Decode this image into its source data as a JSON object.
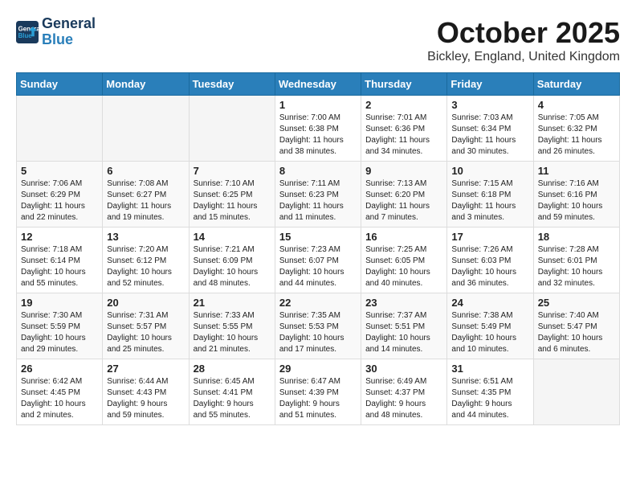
{
  "logo": {
    "line1": "General",
    "line2": "Blue"
  },
  "title": "October 2025",
  "location": "Bickley, England, United Kingdom",
  "weekdays": [
    "Sunday",
    "Monday",
    "Tuesday",
    "Wednesday",
    "Thursday",
    "Friday",
    "Saturday"
  ],
  "weeks": [
    [
      {
        "day": "",
        "info": ""
      },
      {
        "day": "",
        "info": ""
      },
      {
        "day": "",
        "info": ""
      },
      {
        "day": "1",
        "info": "Sunrise: 7:00 AM\nSunset: 6:38 PM\nDaylight: 11 hours\nand 38 minutes."
      },
      {
        "day": "2",
        "info": "Sunrise: 7:01 AM\nSunset: 6:36 PM\nDaylight: 11 hours\nand 34 minutes."
      },
      {
        "day": "3",
        "info": "Sunrise: 7:03 AM\nSunset: 6:34 PM\nDaylight: 11 hours\nand 30 minutes."
      },
      {
        "day": "4",
        "info": "Sunrise: 7:05 AM\nSunset: 6:32 PM\nDaylight: 11 hours\nand 26 minutes."
      }
    ],
    [
      {
        "day": "5",
        "info": "Sunrise: 7:06 AM\nSunset: 6:29 PM\nDaylight: 11 hours\nand 22 minutes."
      },
      {
        "day": "6",
        "info": "Sunrise: 7:08 AM\nSunset: 6:27 PM\nDaylight: 11 hours\nand 19 minutes."
      },
      {
        "day": "7",
        "info": "Sunrise: 7:10 AM\nSunset: 6:25 PM\nDaylight: 11 hours\nand 15 minutes."
      },
      {
        "day": "8",
        "info": "Sunrise: 7:11 AM\nSunset: 6:23 PM\nDaylight: 11 hours\nand 11 minutes."
      },
      {
        "day": "9",
        "info": "Sunrise: 7:13 AM\nSunset: 6:20 PM\nDaylight: 11 hours\nand 7 minutes."
      },
      {
        "day": "10",
        "info": "Sunrise: 7:15 AM\nSunset: 6:18 PM\nDaylight: 11 hours\nand 3 minutes."
      },
      {
        "day": "11",
        "info": "Sunrise: 7:16 AM\nSunset: 6:16 PM\nDaylight: 10 hours\nand 59 minutes."
      }
    ],
    [
      {
        "day": "12",
        "info": "Sunrise: 7:18 AM\nSunset: 6:14 PM\nDaylight: 10 hours\nand 55 minutes."
      },
      {
        "day": "13",
        "info": "Sunrise: 7:20 AM\nSunset: 6:12 PM\nDaylight: 10 hours\nand 52 minutes."
      },
      {
        "day": "14",
        "info": "Sunrise: 7:21 AM\nSunset: 6:09 PM\nDaylight: 10 hours\nand 48 minutes."
      },
      {
        "day": "15",
        "info": "Sunrise: 7:23 AM\nSunset: 6:07 PM\nDaylight: 10 hours\nand 44 minutes."
      },
      {
        "day": "16",
        "info": "Sunrise: 7:25 AM\nSunset: 6:05 PM\nDaylight: 10 hours\nand 40 minutes."
      },
      {
        "day": "17",
        "info": "Sunrise: 7:26 AM\nSunset: 6:03 PM\nDaylight: 10 hours\nand 36 minutes."
      },
      {
        "day": "18",
        "info": "Sunrise: 7:28 AM\nSunset: 6:01 PM\nDaylight: 10 hours\nand 32 minutes."
      }
    ],
    [
      {
        "day": "19",
        "info": "Sunrise: 7:30 AM\nSunset: 5:59 PM\nDaylight: 10 hours\nand 29 minutes."
      },
      {
        "day": "20",
        "info": "Sunrise: 7:31 AM\nSunset: 5:57 PM\nDaylight: 10 hours\nand 25 minutes."
      },
      {
        "day": "21",
        "info": "Sunrise: 7:33 AM\nSunset: 5:55 PM\nDaylight: 10 hours\nand 21 minutes."
      },
      {
        "day": "22",
        "info": "Sunrise: 7:35 AM\nSunset: 5:53 PM\nDaylight: 10 hours\nand 17 minutes."
      },
      {
        "day": "23",
        "info": "Sunrise: 7:37 AM\nSunset: 5:51 PM\nDaylight: 10 hours\nand 14 minutes."
      },
      {
        "day": "24",
        "info": "Sunrise: 7:38 AM\nSunset: 5:49 PM\nDaylight: 10 hours\nand 10 minutes."
      },
      {
        "day": "25",
        "info": "Sunrise: 7:40 AM\nSunset: 5:47 PM\nDaylight: 10 hours\nand 6 minutes."
      }
    ],
    [
      {
        "day": "26",
        "info": "Sunrise: 6:42 AM\nSunset: 4:45 PM\nDaylight: 10 hours\nand 2 minutes."
      },
      {
        "day": "27",
        "info": "Sunrise: 6:44 AM\nSunset: 4:43 PM\nDaylight: 9 hours\nand 59 minutes."
      },
      {
        "day": "28",
        "info": "Sunrise: 6:45 AM\nSunset: 4:41 PM\nDaylight: 9 hours\nand 55 minutes."
      },
      {
        "day": "29",
        "info": "Sunrise: 6:47 AM\nSunset: 4:39 PM\nDaylight: 9 hours\nand 51 minutes."
      },
      {
        "day": "30",
        "info": "Sunrise: 6:49 AM\nSunset: 4:37 PM\nDaylight: 9 hours\nand 48 minutes."
      },
      {
        "day": "31",
        "info": "Sunrise: 6:51 AM\nSunset: 4:35 PM\nDaylight: 9 hours\nand 44 minutes."
      },
      {
        "day": "",
        "info": ""
      }
    ]
  ]
}
